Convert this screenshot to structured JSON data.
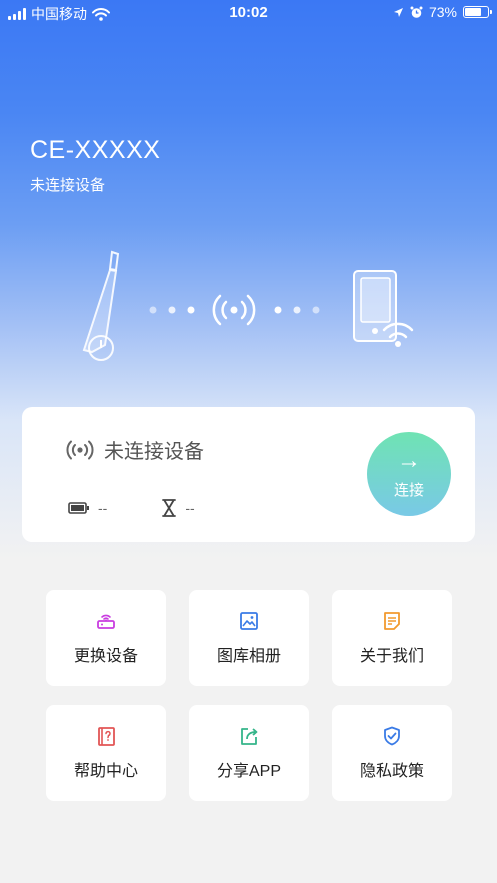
{
  "status_bar": {
    "carrier": "中国移动",
    "time": "10:02",
    "battery_percent": "73%",
    "battery_level": 0.73
  },
  "device": {
    "name": "CE-XXXXX",
    "connection_status": "未连接设备"
  },
  "status_card": {
    "status_text": "未连接设备",
    "battery_value": "--",
    "timer_value": "--",
    "connect_label": "连接"
  },
  "menu": [
    {
      "label": "更换设备",
      "icon": "router-icon",
      "color": "#c93de0"
    },
    {
      "label": "图库相册",
      "icon": "gallery-icon",
      "color": "#3a7be6"
    },
    {
      "label": "关于我们",
      "icon": "document-icon",
      "color": "#f29a2e"
    },
    {
      "label": "帮助中心",
      "icon": "help-book-icon",
      "color": "#e25555"
    },
    {
      "label": "分享APP",
      "icon": "share-icon",
      "color": "#35b58a"
    },
    {
      "label": "隐私政策",
      "icon": "shield-check-icon",
      "color": "#3a7be6"
    }
  ],
  "colors": {
    "hero_top": "#3b78f4",
    "connect_gradient_start": "#6fe3b3",
    "connect_gradient_end": "#79c9e6"
  }
}
